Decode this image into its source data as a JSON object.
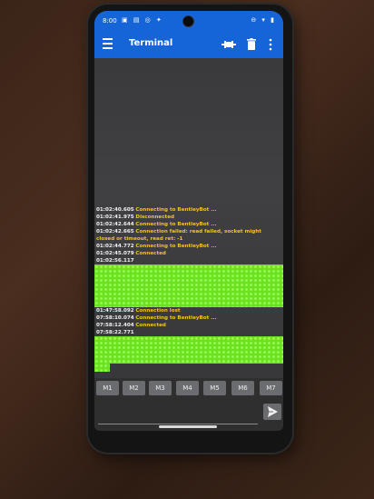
{
  "status_bar": {
    "time": "8:00",
    "left_icons": "▣ ▤ ◎ ✦",
    "right_icons": "⊖ ▾ ▮"
  },
  "app_bar": {
    "title": "Terminal",
    "menu_icon": "hamburger-icon",
    "connect_icon": "plug-connect-icon",
    "clear_icon": "trash-icon",
    "more_icon": "more-vertical-icon",
    "color": "#1565d8"
  },
  "log": [
    {
      "ts": "01:02:40.605",
      "msg": "Connecting to BentleyBot ..."
    },
    {
      "ts": "01:02:41.975",
      "msg": "Disconnected"
    },
    {
      "ts": "01:02:42.644",
      "msg": "Connecting to BentleyBot ..."
    },
    {
      "ts": "01:02:42.665",
      "msg": "Connection failed: read failed, socket might closed or timeout, read ret: -1"
    },
    {
      "ts": "01:02:44.772",
      "msg": "Connecting to BentleyBot ..."
    },
    {
      "ts": "01:02:45.079",
      "msg": "Connected"
    },
    {
      "ts": "01:02:56.117",
      "msg": ""
    },
    {
      "ts": "01:47:58.092",
      "msg": "Connection lost"
    },
    {
      "ts": "07:58:10.074",
      "msg": "Connecting to BentleyBot ..."
    },
    {
      "ts": "07:58:12.404",
      "msg": "Connected"
    },
    {
      "ts": "07:58:22.771",
      "msg": ""
    }
  ],
  "macros": [
    "M1",
    "M2",
    "M3",
    "M4",
    "M5",
    "M6",
    "M7"
  ],
  "input": {
    "value": "",
    "placeholder": ""
  },
  "colors": {
    "timestamp": "#f2f2f2",
    "message": "#f5c518",
    "received_data": "#6be11f"
  }
}
